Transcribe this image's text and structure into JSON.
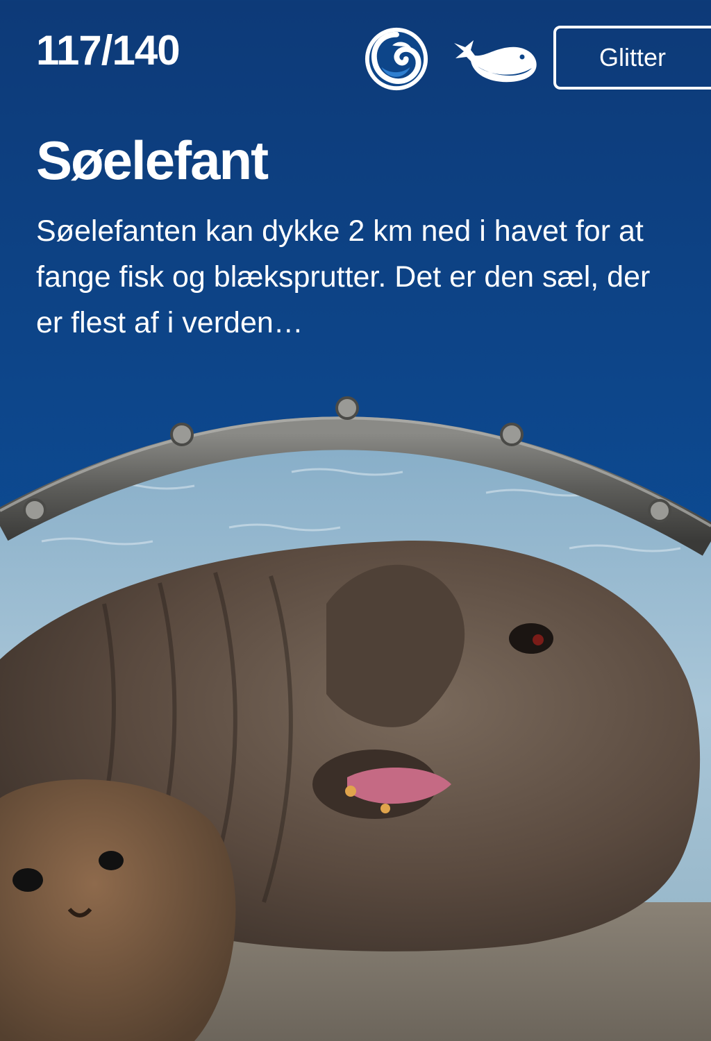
{
  "card": {
    "counter": "117/140",
    "title": "Søelefant",
    "description": "Søelefanten kan dykke 2 km ned i havet for at fange fisk og blæksprutter. Det er den sæl, der er flest af i verden…",
    "rarity_label": "Glitter"
  },
  "icons": {
    "habitat": "ocean-wave-icon",
    "category": "whale-icon"
  },
  "colors": {
    "background": "#0d4589",
    "text": "#ffffff"
  }
}
